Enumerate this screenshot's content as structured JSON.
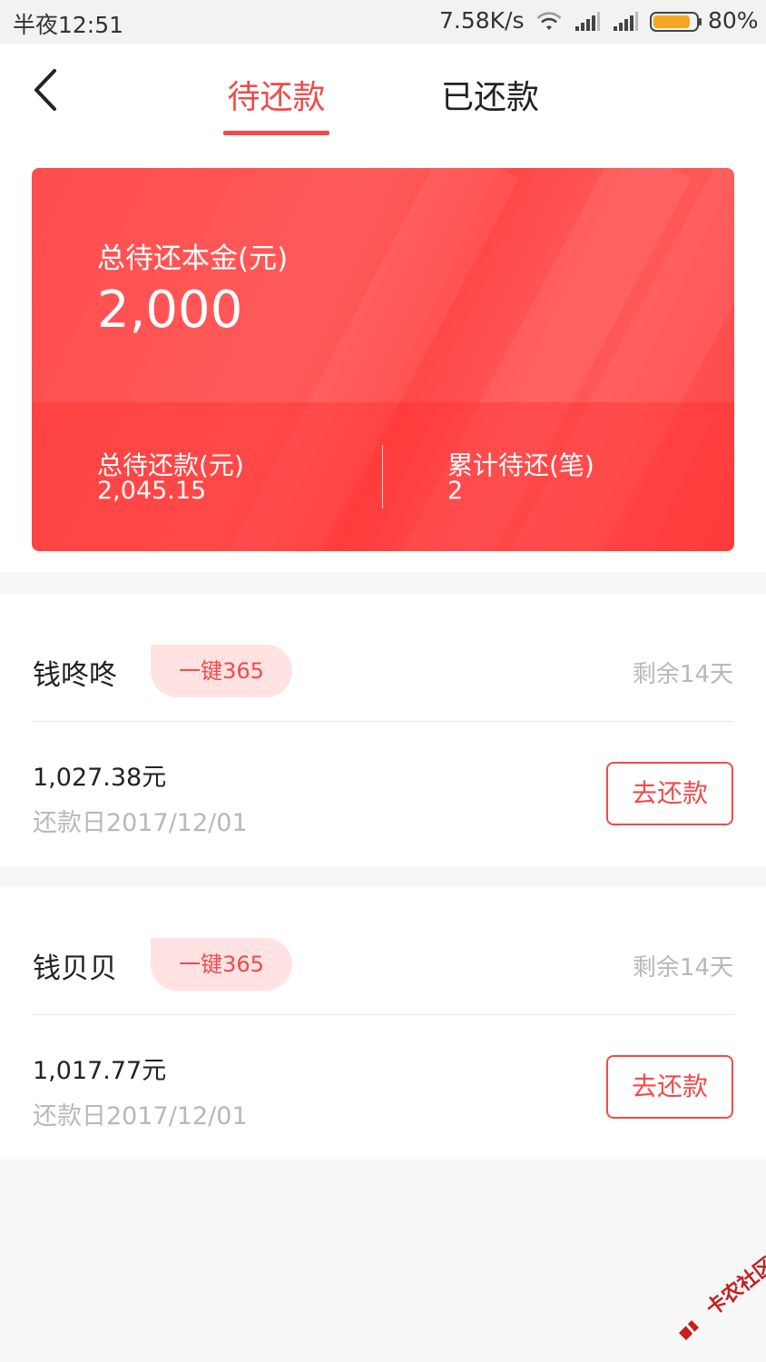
{
  "status_bar": {
    "time": "半夜12:51",
    "network_speed": "7.58K/s",
    "battery": "80%",
    "icons": [
      "wifi-icon",
      "signal-icon",
      "signal-icon",
      "battery-icon"
    ]
  },
  "nav": {
    "back_icon": "chevron-left-icon",
    "tabs": [
      {
        "label": "待还款",
        "active": true
      },
      {
        "label": "已还款",
        "active": false
      }
    ]
  },
  "summary": {
    "principal_label": "总待还本金(元)",
    "principal_value": "2,000",
    "total_due_label": "总待还款(元)",
    "total_due_value": "2,045.15",
    "count_label": "累计待还(笔)",
    "count_value": "2"
  },
  "loans": [
    {
      "name": "钱咚咚",
      "tag": "一键365",
      "remaining": "剩余14天",
      "amount": "1,027.38元",
      "due_date": "还款日2017/12/01",
      "button": "去还款"
    },
    {
      "name": "钱贝贝",
      "tag": "一键365",
      "remaining": "剩余14天",
      "amount": "1,017.77元",
      "due_date": "还款日2017/12/01",
      "button": "去还款"
    }
  ],
  "watermark": {
    "text": "卡农社区"
  },
  "colors": {
    "accent": "#f24a4a",
    "card": "#ff4d4d",
    "tag_bg": "#ffe3e3",
    "muted": "#b8b8b8"
  }
}
